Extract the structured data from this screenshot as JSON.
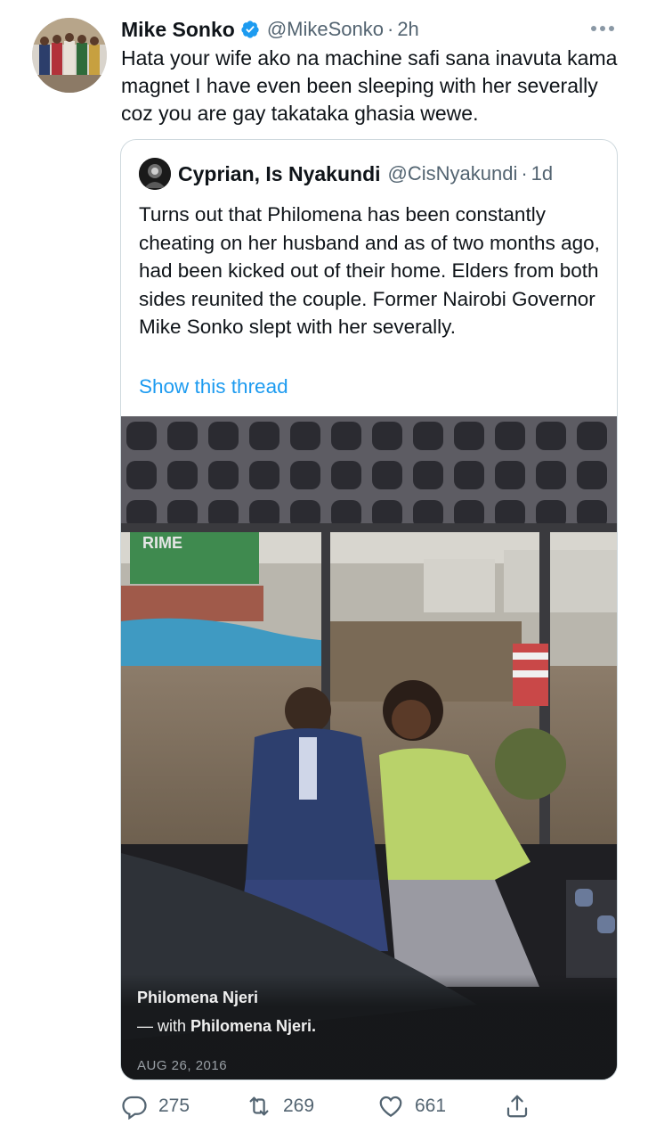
{
  "tweet": {
    "display_name": "Mike Sonko",
    "handle": "@MikeSonko",
    "separator": "·",
    "time": "2h",
    "text": "Hata your wife ako na machine safi sana inavuta kama magnet I have even been sleeping with her severally  coz you are gay takataka ghasia wewe.",
    "verified_icon": "verified-badge-icon",
    "more_icon": "more-options-icon"
  },
  "quote": {
    "display_name": "Cyprian, Is Nyakundi",
    "handle": "@CisNyakundi",
    "separator": "·",
    "time": "1d",
    "text": "Turns out that Philomena has been constantly cheating on her husband and as of two months ago, had been kicked out of their home. Elders from both sides reunited the couple. Former Nairobi Governor Mike Sonko slept with her severally.",
    "show_thread": "Show this thread",
    "photo": {
      "caption_name": "Philomena Njeri",
      "caption_with_prefix": "— with ",
      "caption_with_name": "Philomena Njeri.",
      "date": "AUG 26, 2016",
      "sign_text": "RIME"
    }
  },
  "actions": {
    "reply_count": "275",
    "retweet_count": "269",
    "like_count": "661",
    "icons": [
      "reply-icon",
      "retweet-icon",
      "like-icon",
      "share-icon"
    ]
  },
  "colors": {
    "link": "#1d9bf0",
    "secondary_text": "#536471",
    "border": "#cfd9de"
  }
}
